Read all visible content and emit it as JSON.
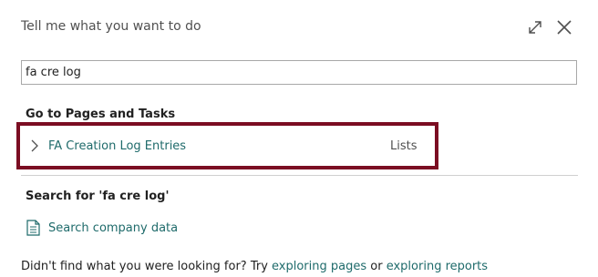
{
  "header": {
    "title": "Tell me what you want to do"
  },
  "search": {
    "value": "fa cre log"
  },
  "pages_section": {
    "heading": "Go to Pages and Tasks",
    "results": [
      {
        "label": "FA Creation Log Entries",
        "type": "Lists"
      }
    ]
  },
  "search_section": {
    "heading": "Search for 'fa cre log'",
    "company_link": "Search company data"
  },
  "footer": {
    "prefix": "Didn't find what you were looking for? Try ",
    "link1": "exploring pages",
    "middle": " or ",
    "link2": "exploring reports"
  },
  "colors": {
    "highlight_border": "#7b0d22",
    "link": "#1f6b6b"
  }
}
